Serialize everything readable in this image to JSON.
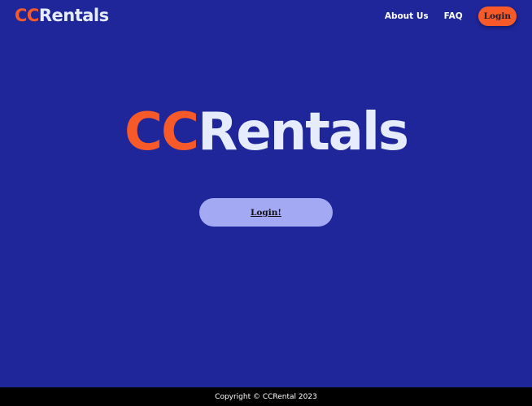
{
  "colors": {
    "background": "#1e2699",
    "accent": "#f75a28",
    "logo_text": "#e6ecfb",
    "hero_button": "#a4a9f4",
    "footer_background": "#000000"
  },
  "header": {
    "logo": {
      "prefix": "CC",
      "suffix": "Rentals"
    },
    "nav": {
      "about_label": "About Us",
      "faq_label": "FAQ",
      "login_label": "Login"
    }
  },
  "hero": {
    "logo": {
      "prefix": "CC",
      "suffix": "Rentals"
    },
    "button_label": "Login!"
  },
  "footer": {
    "copyright": "Copyright © CCRental 2023"
  }
}
